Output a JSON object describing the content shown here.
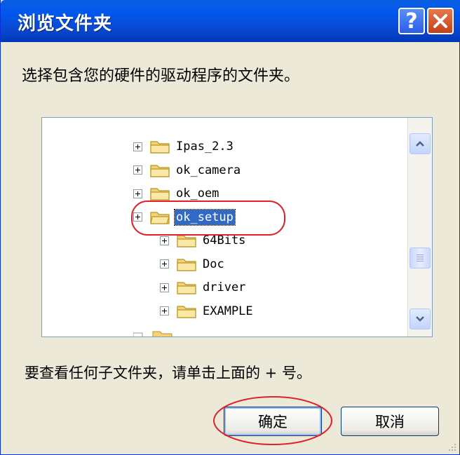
{
  "dialog": {
    "title": "浏览文件夹",
    "help_label": "?",
    "instruction": "选择包含您的硬件的驱动程序的文件夹。",
    "hint": "要查看任何子文件夹，请单击上面的 + 号。",
    "ok_label": "确定",
    "cancel_label": "取消"
  },
  "tree": {
    "items": [
      {
        "label": "Ipas_2.3",
        "level": 1,
        "selected": false
      },
      {
        "label": "ok_camera",
        "level": 1,
        "selected": false
      },
      {
        "label": "ok_oem",
        "level": 1,
        "selected": false
      },
      {
        "label": "ok_setup",
        "level": 1,
        "selected": true
      },
      {
        "label": "64Bits",
        "level": 2,
        "selected": false
      },
      {
        "label": "Doc",
        "level": 2,
        "selected": false
      },
      {
        "label": "driver",
        "level": 2,
        "selected": false
      },
      {
        "label": "EXAMPLE",
        "level": 2,
        "selected": false
      }
    ]
  },
  "colors": {
    "titlebar": "#0058ee",
    "selection": "#316ac5",
    "annotation": "#e0202a",
    "folder": "#f5d27a"
  }
}
